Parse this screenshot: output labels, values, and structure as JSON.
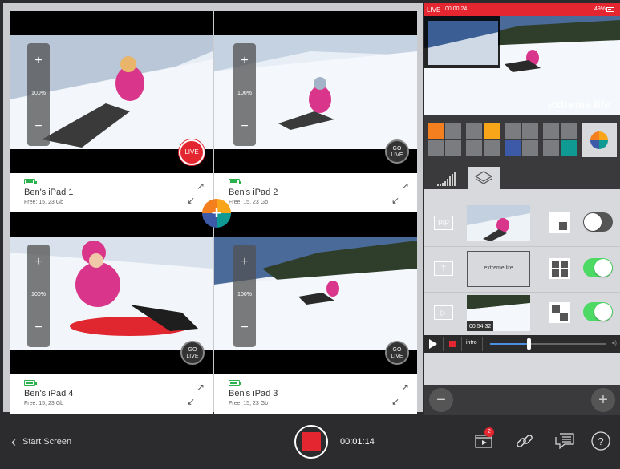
{
  "preview": {
    "status": "LIVE",
    "time": "00:00:24",
    "battery": "49%",
    "overlay_title": "extreme life"
  },
  "cameras": [
    {
      "name": "Ben's iPad 1",
      "free": "Free: 15, 23 Gb",
      "zoom": "100%",
      "state": "LIVE"
    },
    {
      "name": "Ben's iPad 2",
      "free": "Free: 15, 23 Gb",
      "zoom": "100%",
      "state": "GO LIVE"
    },
    {
      "name": "Ben's iPad 4",
      "free": "Free: 15, 23 Gb",
      "zoom": "100%",
      "state": "GO LIVE"
    },
    {
      "name": "Ben's iPad 3",
      "free": "Free: 15, 23 Gb",
      "zoom": "100%",
      "state": "GO LIVE"
    }
  ],
  "go_live_line1": "GO",
  "go_live_line2": "LIVE",
  "layers": {
    "pip_label": "PiP",
    "title_icon": "T",
    "title_text": "extreme life",
    "clip_time": "00:54:32",
    "pip_on": false,
    "title_on": true,
    "clip_on": true
  },
  "transport": {
    "clip_name": "intro",
    "progress": 0.33
  },
  "bottombar": {
    "back_label": "Start Screen",
    "timer": "00:01:14",
    "notif_count": "2"
  },
  "colors": {
    "live_red": "#e3262f",
    "toggle_green": "#4cd964",
    "accent_orange": "#f47f1f",
    "accent_blue": "#3c5aa8",
    "accent_teal": "#0f9a93"
  }
}
